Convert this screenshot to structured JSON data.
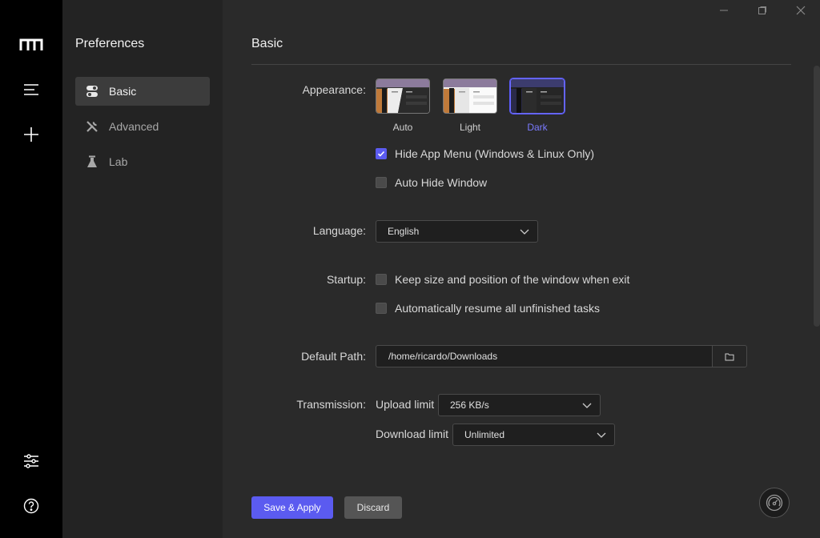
{
  "sidebar": {
    "title": "Preferences",
    "items": [
      {
        "label": "Basic"
      },
      {
        "label": "Advanced"
      },
      {
        "label": "Lab"
      }
    ]
  },
  "main": {
    "title": "Basic",
    "appearance": {
      "label": "Appearance:",
      "options": [
        {
          "label": "Auto"
        },
        {
          "label": "Light"
        },
        {
          "label": "Dark"
        }
      ],
      "selected": "Dark",
      "hide_app_menu": "Hide App Menu (Windows & Linux Only)",
      "auto_hide_window": "Auto Hide Window"
    },
    "language": {
      "label": "Language:",
      "value": "English"
    },
    "startup": {
      "label": "Startup:",
      "keep_size": "Keep size and position of the window when exit",
      "resume_tasks": "Automatically resume all unfinished tasks"
    },
    "default_path": {
      "label": "Default Path:",
      "value": "/home/ricardo/Downloads"
    },
    "transmission": {
      "label": "Transmission:",
      "upload_label": "Upload limit",
      "upload_value": "256 KB/s",
      "download_label": "Download limit",
      "download_value": "Unlimited"
    },
    "buttons": {
      "save": "Save & Apply",
      "discard": "Discard"
    }
  },
  "colors": {
    "accent": "#5b5bf0",
    "rail": "#000000",
    "sidebar": "#232323",
    "main": "#2a2a2a"
  }
}
